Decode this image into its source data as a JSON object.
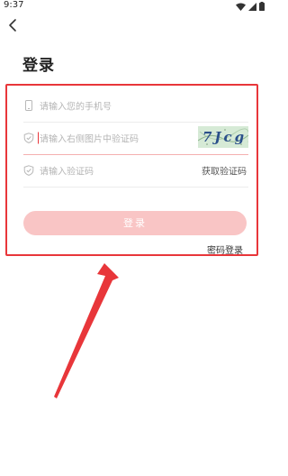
{
  "status_bar": {
    "time": "9:37"
  },
  "header": {
    "title": "登录"
  },
  "form": {
    "phone_placeholder": "请输入您的手机号",
    "captcha_placeholder": "请输入右侧图片中验证码",
    "captcha_image_text": "7Jcg",
    "sms_placeholder": "请输入验证码",
    "get_code_label": "获取验证码",
    "login_button_label": "登录",
    "password_login_label": "密码登录"
  },
  "colors": {
    "accent": "#e8363a",
    "button_disabled": "#f9c5c5"
  },
  "icons": {
    "back": "chevron-left-icon",
    "phone": "phone-icon",
    "shield": "shield-check-icon"
  }
}
